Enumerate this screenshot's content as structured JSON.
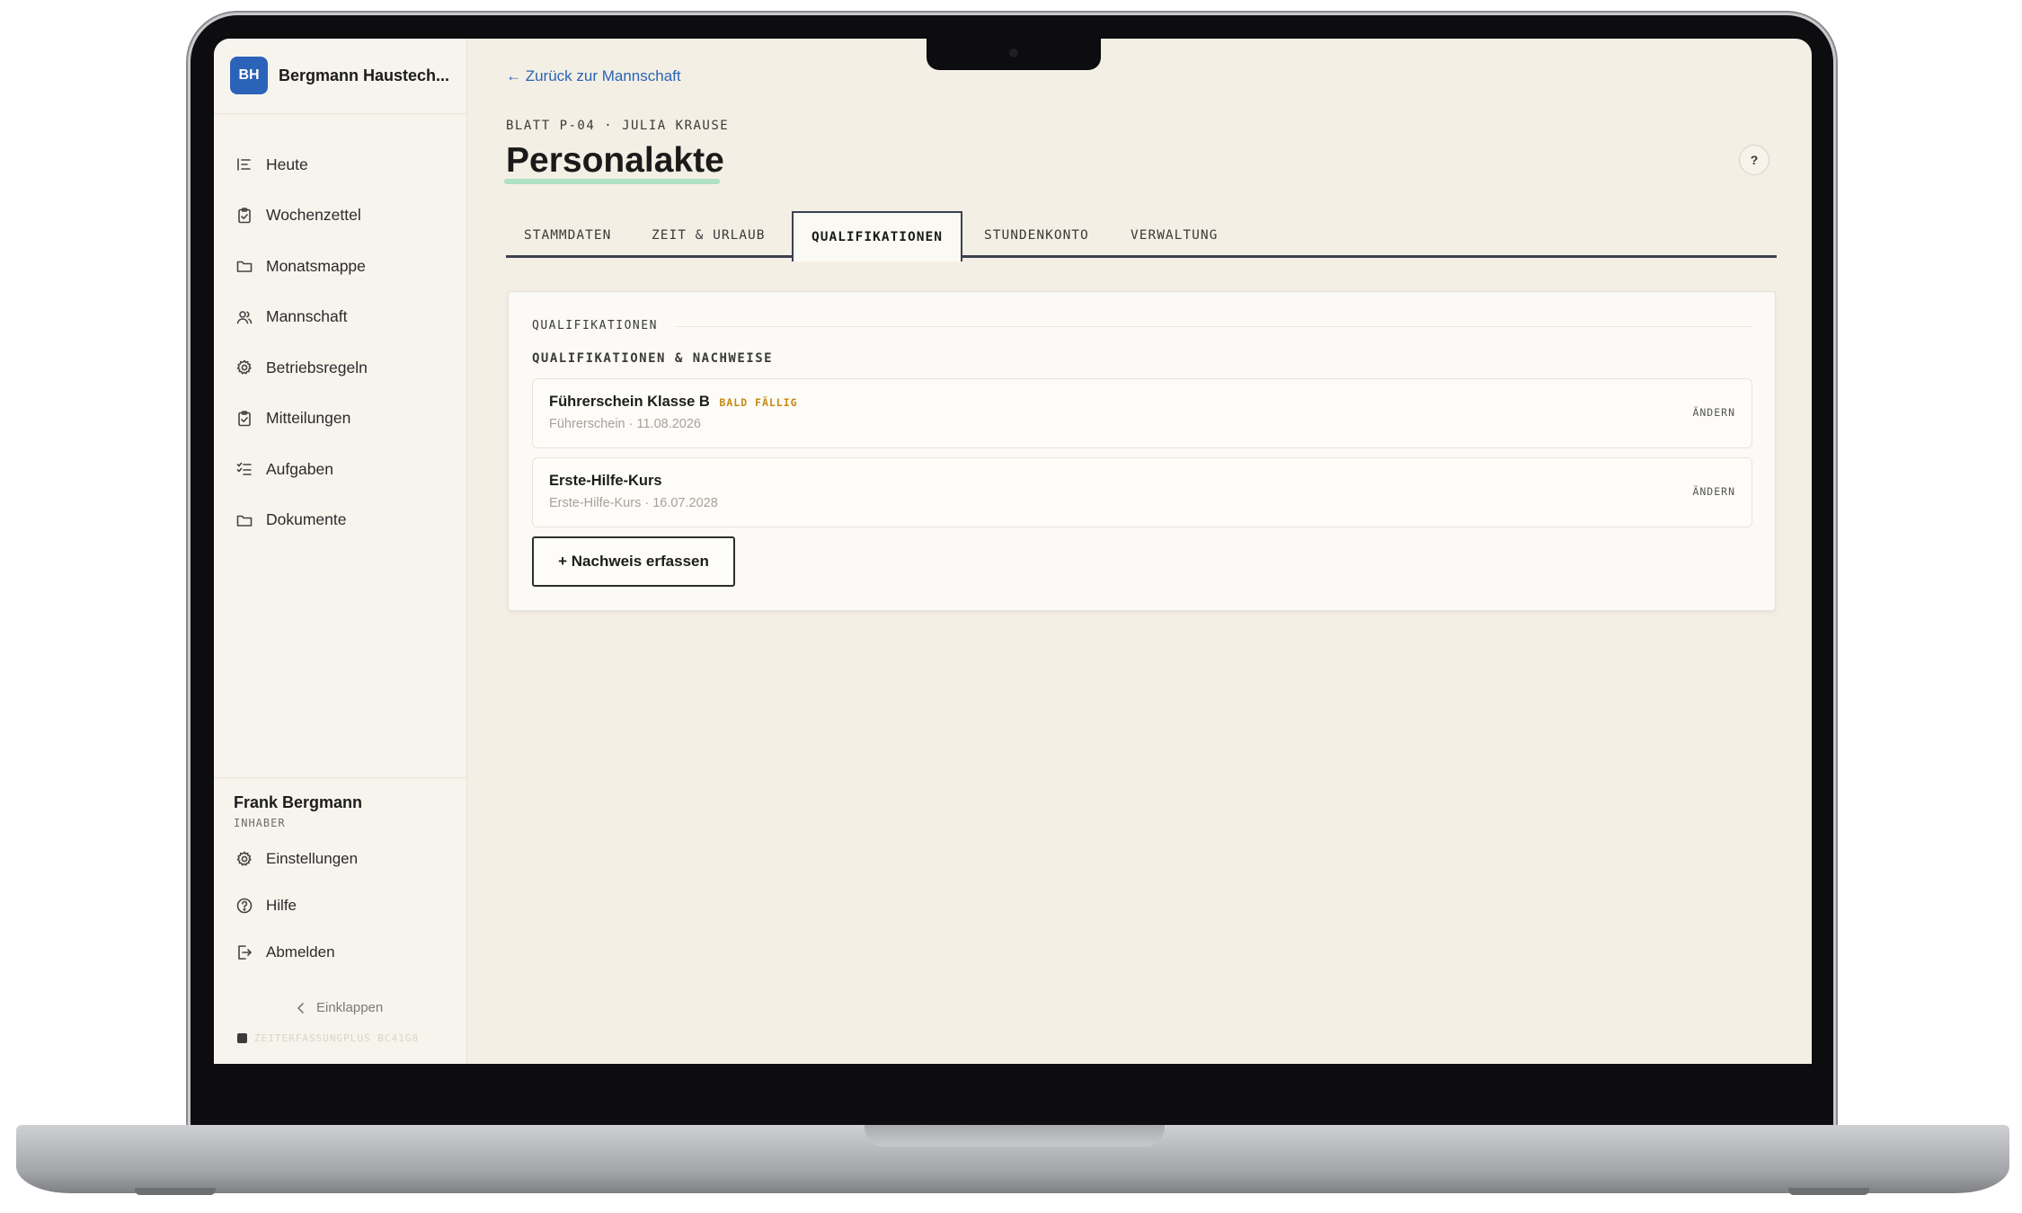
{
  "sidebar": {
    "brand_initials": "BH",
    "brand_name": "Bergmann Haustech...",
    "items": [
      {
        "label": "Heute",
        "icon": "today-list-icon"
      },
      {
        "label": "Wochenzettel",
        "icon": "clipboard-check-icon"
      },
      {
        "label": "Monatsmappe",
        "icon": "folder-icon"
      },
      {
        "label": "Mannschaft",
        "icon": "users-icon"
      },
      {
        "label": "Betriebsregeln",
        "icon": "gear-icon"
      },
      {
        "label": "Mitteilungen",
        "icon": "clipboard-check-icon"
      },
      {
        "label": "Aufgaben",
        "icon": "checklist-icon"
      },
      {
        "label": "Dokumente",
        "icon": "folder-icon"
      }
    ],
    "user": {
      "name": "Frank Bergmann",
      "role": "INHABER"
    },
    "bottom_items": [
      {
        "label": "Einstellungen",
        "icon": "gear-icon"
      },
      {
        "label": "Hilfe",
        "icon": "help-circle-icon"
      },
      {
        "label": "Abmelden",
        "icon": "logout-icon"
      }
    ],
    "collapse_label": "Einklappen",
    "version": "ZEITERFASSUNGPLUS BC41G8"
  },
  "main": {
    "back_link": "← Zurück zur Mannschaft",
    "eyebrow": "BLATT P-04 · JULIA KRAUSE",
    "title": "Personalakte",
    "help_label": "?",
    "tabs": [
      "STAMMDATEN",
      "ZEIT & URLAUB",
      "QUALIFIKATIONEN",
      "STUNDENKONTO",
      "VERWALTUNG"
    ],
    "active_tab": "QUALIFIKATIONEN",
    "section_label": "QUALIFIKATIONEN",
    "subsection_label": "QUALIFIKATIONEN & NACHWEISE",
    "qualifications": [
      {
        "name": "Führerschein Klasse B",
        "badge": "BALD FÄLLIG",
        "meta": "Führerschein · 11.08.2026",
        "action": "ÄNDERN"
      },
      {
        "name": "Erste-Hilfe-Kurs",
        "badge": "",
        "meta": "Erste-Hilfe-Kurs · 16.07.2028",
        "action": "ÄNDERN"
      }
    ],
    "add_button": "+ Nachweis erfassen"
  },
  "colors": {
    "accent": "#2a63b8",
    "warning": "#c58a12",
    "background": "#f4efe4",
    "title_highlight": "#a7dfc1"
  }
}
